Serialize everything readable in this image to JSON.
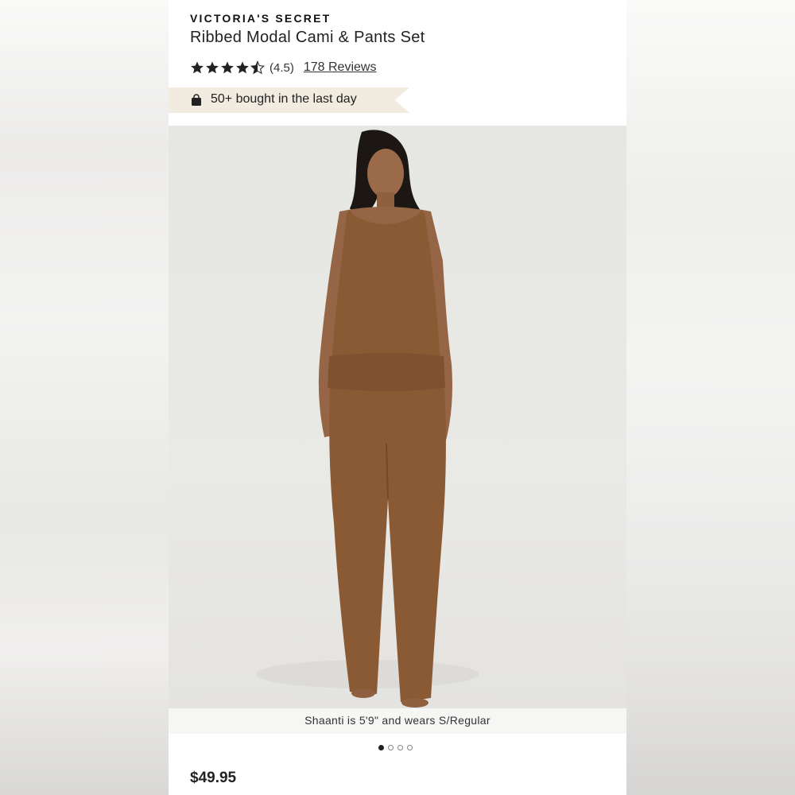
{
  "product": {
    "brand": "VICTORIA'S SECRET",
    "title": "Ribbed Modal Cami & Pants Set",
    "rating": 4.5,
    "rating_label": "(4.5)",
    "reviews_label": "178 Reviews",
    "badge_text": "50+ bought in the last day",
    "image_caption": "Shaanti is 5'9\" and wears S/Regular",
    "carousel_total": 4,
    "carousel_active": 1,
    "price": "$49.95"
  },
  "colors": {
    "badge_bg": "#f1ebe0",
    "garment": "#8a5a35"
  },
  "icons": {
    "star": "star-icon",
    "half_star": "half-star-icon",
    "bag": "shopping-bag-icon"
  }
}
